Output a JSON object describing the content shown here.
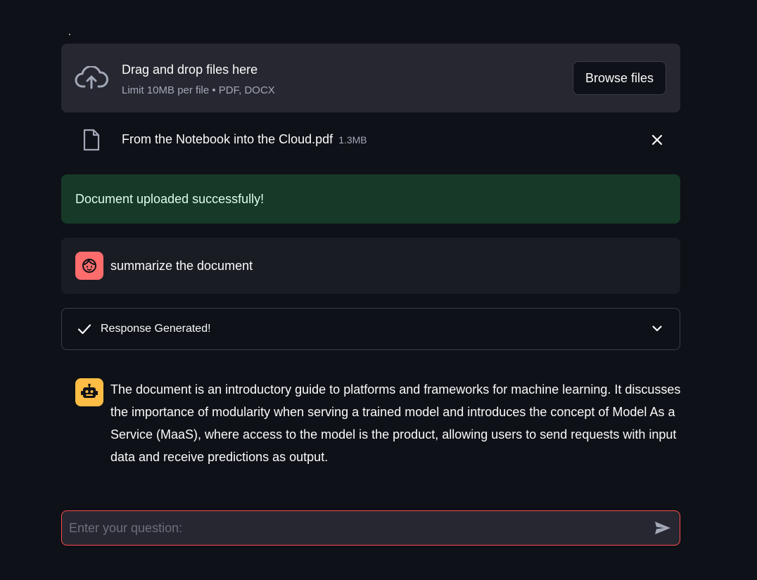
{
  "uploader": {
    "title": "Drag and drop files here",
    "limit": "Limit 10MB per file • PDF, DOCX",
    "browse_label": "Browse files",
    "icon": "cloud-upload-icon"
  },
  "file": {
    "name": "From the Notebook into the Cloud.pdf",
    "size": "1.3MB",
    "icon": "file-icon",
    "remove_icon": "close-icon"
  },
  "status": {
    "message": "Document uploaded successfully!",
    "color": "#173928"
  },
  "user_message": {
    "text": "summarize the document",
    "avatar_color": "#ff6c6c",
    "icon": "user-face-icon"
  },
  "expander": {
    "label": "Response Generated!",
    "icon": "check-icon",
    "toggle_icon": "chevron-down-icon"
  },
  "assistant_message": {
    "text": "The document is an introductory guide to platforms and frameworks for machine learning. It discusses the importance of modularity when serving a trained model and introduces the concept of Model As a Service (MaaS), where access to the model is the product, allowing users to send requests with input data and receive predictions as output.",
    "avatar_color": "#ffbd45",
    "icon": "robot-icon"
  },
  "chat_input": {
    "placeholder": "Enter your question:",
    "value": "",
    "send_icon": "send-icon",
    "accent": "#ff4b4b"
  }
}
